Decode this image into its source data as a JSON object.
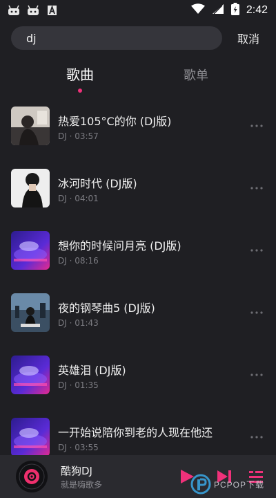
{
  "status_bar": {
    "time": "2:42",
    "notification_icons": [
      "android-robot-icon",
      "android-robot-icon",
      "font-a-icon"
    ],
    "system_icons": [
      "wifi-icon",
      "signal-icon",
      "battery-icon"
    ]
  },
  "search": {
    "value": "dj",
    "cancel_label": "取消"
  },
  "tabs": [
    {
      "label": "歌曲",
      "active": true
    },
    {
      "label": "歌单",
      "active": false
    }
  ],
  "songs": [
    {
      "title": "热爱105°C的你 (DJ版)",
      "meta": "DJ · 03:57",
      "cover": "portrait-dark"
    },
    {
      "title": "冰河时代 (DJ版)",
      "meta": "DJ · 04:01",
      "cover": "portrait-light"
    },
    {
      "title": "想你的时候问月亮 (DJ版)",
      "meta": "DJ · 08:16",
      "cover": "dj-turntable"
    },
    {
      "title": "夜的钢琴曲5 (DJ版)",
      "meta": "DJ · 01:43",
      "cover": "city-night"
    },
    {
      "title": "英雄泪 (DJ版)",
      "meta": "DJ · 01:35",
      "cover": "dj-turntable"
    },
    {
      "title": "一开始说陪你到老的人现在他还",
      "meta": "DJ · 03:55",
      "cover": "dj-turntable"
    }
  ],
  "player": {
    "title": "酷狗DJ",
    "subtitle": "就是嗨歌多"
  },
  "watermark": {
    "text": "PCPOP下载"
  },
  "colors": {
    "background": "#1f1f23",
    "accent": "#f0317a",
    "search_bg": "#35353b",
    "player_bg": "#2a2a2f",
    "muted_text": "#7c7c82"
  }
}
